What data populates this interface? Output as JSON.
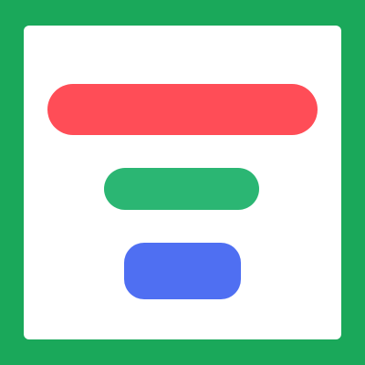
{
  "app": {
    "title": ""
  },
  "buttons": [
    {
      "label": "",
      "color": "#ff4d57"
    },
    {
      "label": "",
      "color": "#2bb673"
    },
    {
      "label": "",
      "color": "#4f6ff2"
    }
  ],
  "colors": {
    "frame": "#1aa85a",
    "panel": "#ffffff"
  }
}
